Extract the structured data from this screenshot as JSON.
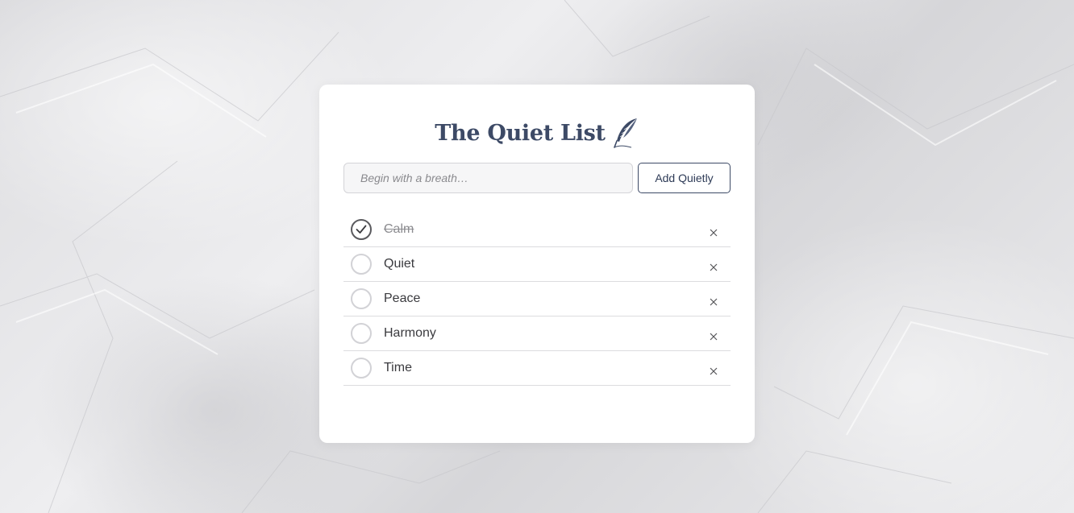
{
  "app": {
    "title": "The Quiet List",
    "title_icon": "quill-feather-icon"
  },
  "composer": {
    "input_value": "",
    "placeholder": "Begin with a breath…",
    "add_label": "Add Quietly"
  },
  "tasks": [
    {
      "label": "Calm",
      "done": true
    },
    {
      "label": "Quiet",
      "done": false
    },
    {
      "label": "Peace",
      "done": false
    },
    {
      "label": "Harmony",
      "done": false
    },
    {
      "label": "Time",
      "done": false
    }
  ],
  "icons": {
    "complete": "checkmark-icon",
    "delete": "close-icon"
  },
  "colors": {
    "accent": "#3d4a66",
    "card": "#ffffff",
    "done_text": "#8c8c90"
  }
}
